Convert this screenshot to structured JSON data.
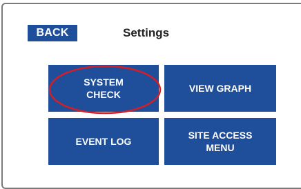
{
  "header": {
    "back_label": "BACK",
    "title": "Settings"
  },
  "menu": {
    "tiles": [
      {
        "label": "SYSTEM\nCHECK"
      },
      {
        "label": "VIEW GRAPH"
      },
      {
        "label": "EVENT LOG"
      },
      {
        "label": "SITE ACCESS\nMENU"
      }
    ]
  },
  "colors": {
    "tile_background": "#1f4e9a",
    "tile_text": "#ffffff",
    "highlight": "#d11f2a"
  }
}
